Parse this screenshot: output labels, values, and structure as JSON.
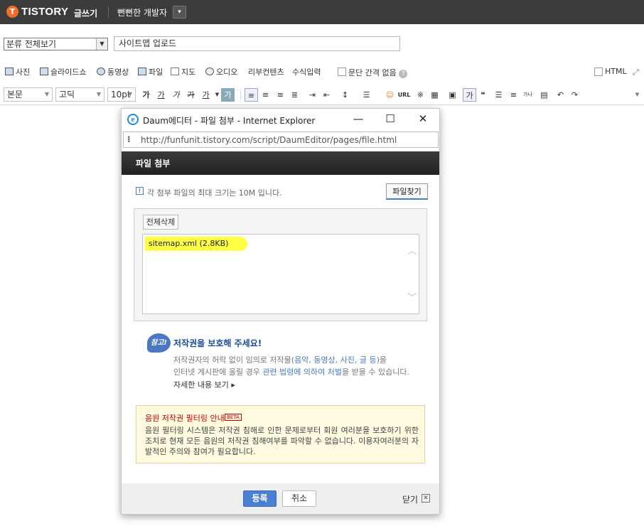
{
  "topbar": {
    "logo_glyph": "T",
    "brand": "TISTORY",
    "write_label": "글쓰기",
    "blog_name": "뻔뻔한 개발자",
    "dropdown_glyph": "▾"
  },
  "editor": {
    "category": "분류 전체보기",
    "title": "사이트맵 업로드",
    "insert_tools": [
      "사진",
      "슬라이드쇼",
      "동영상",
      "파일",
      "지도",
      "오디오",
      "리부컨텐츠",
      "수식입력"
    ],
    "paragraph_option": "문단 간격 없음",
    "html_label": "HTML",
    "format_select": "본문",
    "font_select": "고딕",
    "size_select": "10pt",
    "format_buttons": [
      "가",
      "가",
      "가",
      "가",
      "가"
    ],
    "url_label": "URL"
  },
  "dialog": {
    "window_title": "Daum에디터 - 파일 첨부 - Internet Explorer",
    "address": "http://funfunit.tistory.com/script/DaumEditor/pages/file.html",
    "heading": "파일 첨부",
    "info_text": "각 첨부 파일의 최대 크기는 10M 입니다.",
    "find_button": "파일찾기",
    "delete_all_button": "전체삭제",
    "files": [
      "sitemap.xml (2.8KB)"
    ],
    "copyright": {
      "badge": "참고!",
      "title": "저작권을 보호해 주세요!",
      "line1_a": "저작권자의 허락 없이 임의로 저작물(",
      "line1_b": "음악, 동영상, 사진, 글 등",
      "line1_c": ")을",
      "line2_a": "인터넷 게시판에 올릴 경우 ",
      "line2_b": "관련 법령에 의하여 처벌",
      "line2_c": "을 받을 수 있습니다.",
      "more": "자세한 내용 보기 ▸"
    },
    "notice": {
      "title": "음원 저작권 필터링 안내",
      "badge": "BETA",
      "body": "음원 필터링 시스템은 저작권 침해로 인한 문제로부터 회원 여러분을 보호하기 위한 조치로 현재 모든 음원의 저작권 침해여부를 파악할 수 없습니다. 이용자여러분의 자발적인 주의와 참여가 필요합니다."
    },
    "register_button": "등록",
    "cancel_button": "취소",
    "close_label": "닫기"
  }
}
